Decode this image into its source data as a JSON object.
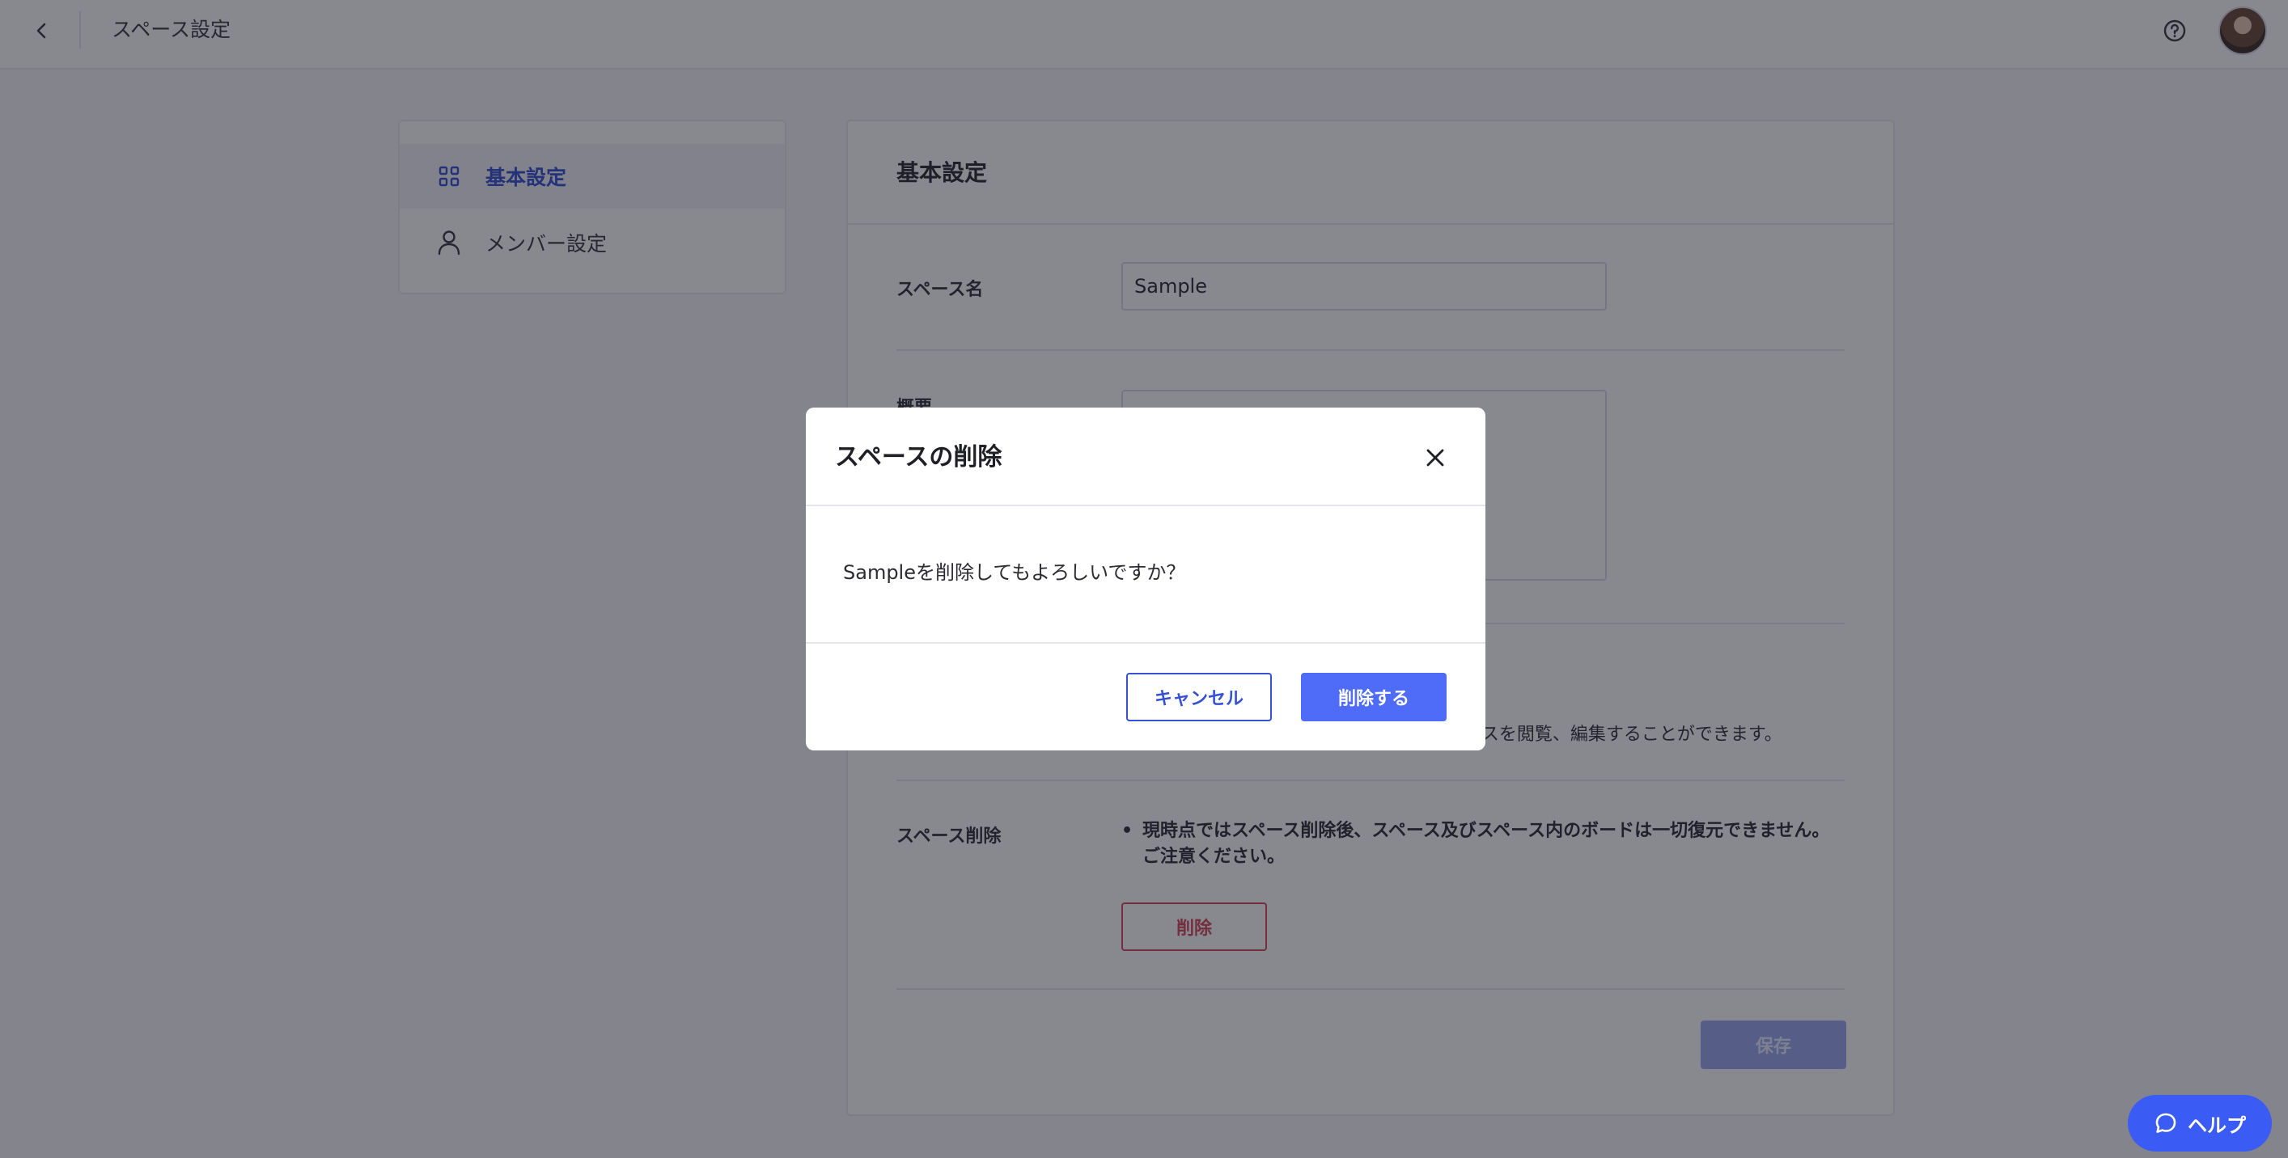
{
  "header": {
    "title": "スペース設定"
  },
  "sidebar": {
    "items": [
      {
        "label": "基本設定",
        "icon": "grid-icon",
        "active": true
      },
      {
        "label": "メンバー設定",
        "icon": "person-icon",
        "active": false
      }
    ]
  },
  "main": {
    "title": "基本設定",
    "space_name_label": "スペース名",
    "space_name_value": "Sample",
    "summary_label": "概要",
    "permission_note": "ースを閲覧、編集することができます。",
    "delete_section_label": "スペース削除",
    "delete_warning": "現時点ではスペース削除後、スペース及びスペース内のボードは一切復元できません。ご注意ください。",
    "delete_button": "削除",
    "save_button": "保存"
  },
  "modal": {
    "title": "スペースの削除",
    "message": "Sampleを削除してもよろしいですか？",
    "cancel_label": "キャンセル",
    "confirm_label": "削除する"
  },
  "help_fab": {
    "label": "ヘルプ"
  },
  "colors": {
    "accent": "#3651d4",
    "primary_button": "#4e6cf7",
    "danger": "#d44a5c",
    "help_button": "#3a5cf5"
  }
}
